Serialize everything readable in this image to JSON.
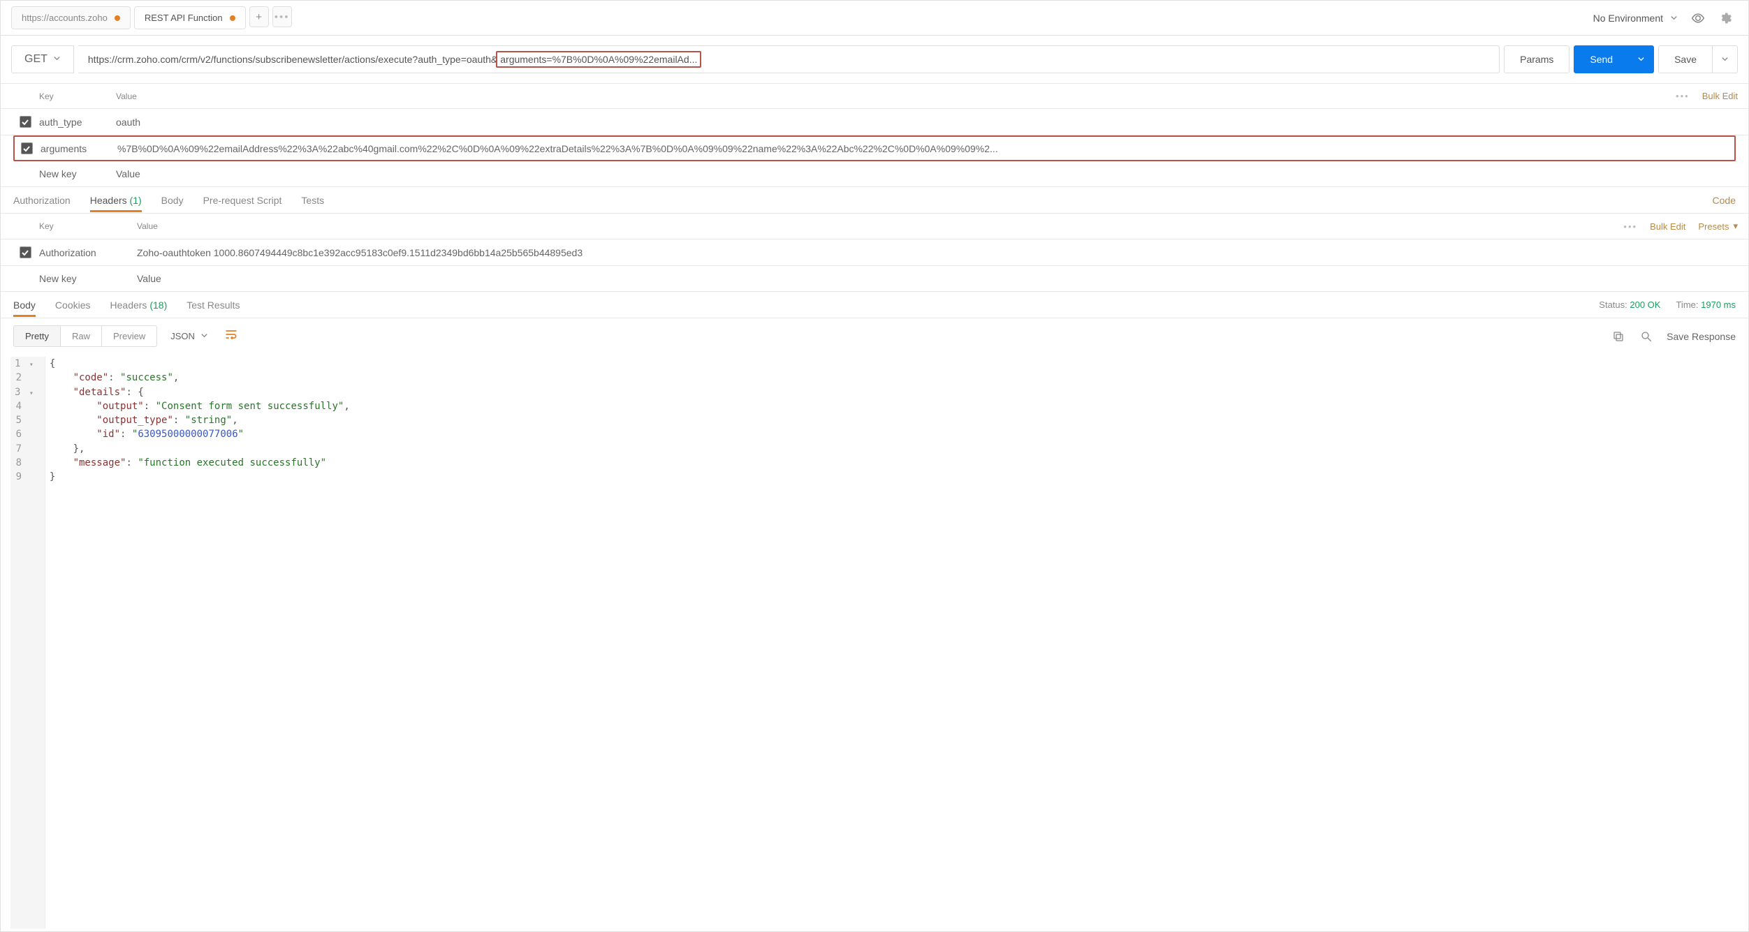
{
  "topbar": {
    "tabs": [
      {
        "label": "https://accounts.zoho",
        "dot_color": "#e67e22"
      },
      {
        "label": "REST API Function",
        "dot_color": "#e67e22"
      }
    ],
    "environment": "No Environment"
  },
  "request": {
    "method": "GET",
    "url_prefix": "https://crm.zoho.com/crm/v2/functions/subscribenewsletter/actions/execute?auth_type=oauth&",
    "url_highlight": "arguments=%7B%0D%0A%09%22emailAd...",
    "params_btn": "Params",
    "send_btn": "Send",
    "save_btn": "Save"
  },
  "params": {
    "header_key": "Key",
    "header_value": "Value",
    "bulk_edit": "Bulk Edit",
    "rows": [
      {
        "key": "auth_type",
        "value": "oauth"
      },
      {
        "key": "arguments",
        "value": "%7B%0D%0A%09%22emailAddress%22%3A%22abc%40gmail.com%22%2C%0D%0A%09%22extraDetails%22%3A%7B%0D%0A%09%09%22name%22%3A%22Abc%22%2C%0D%0A%09%09%2..."
      }
    ],
    "new_key": "New key",
    "new_value": "Value"
  },
  "reqTabs": {
    "authorization": "Authorization",
    "headers": "Headers",
    "headers_count": "(1)",
    "body": "Body",
    "prerequest": "Pre-request Script",
    "tests": "Tests",
    "code": "Code"
  },
  "headersTable": {
    "header_key": "Key",
    "header_value": "Value",
    "bulk_edit": "Bulk Edit",
    "presets": "Presets",
    "rows": [
      {
        "key": "Authorization",
        "value": "Zoho-oauthtoken 1000.8607494449c8bc1e392acc95183c0ef9.1511d2349bd6bb14a25b565b44895ed3"
      }
    ],
    "new_key": "New key",
    "new_value": "Value"
  },
  "respTabs": {
    "body": "Body",
    "cookies": "Cookies",
    "headers": "Headers",
    "headers_count": "(18)",
    "test_results": "Test Results",
    "status_label": "Status:",
    "status_value": "200 OK",
    "time_label": "Time:",
    "time_value": "1970 ms"
  },
  "viewer": {
    "pills": {
      "pretty": "Pretty",
      "raw": "Raw",
      "preview": "Preview"
    },
    "format": "JSON",
    "save_response": "Save Response"
  },
  "responseBody": {
    "code": "success",
    "details": {
      "output": "Consent form sent successfully",
      "output_type": "string",
      "id": "63095000000077006"
    },
    "message": "function executed successfully"
  }
}
